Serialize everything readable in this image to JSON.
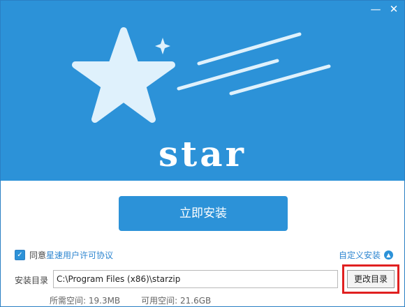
{
  "window": {
    "minimize_glyph": "—",
    "close_glyph": "✕"
  },
  "banner": {
    "brand": "star",
    "bg_color": "#2c92d8"
  },
  "install_button": "立即安装",
  "agreement": {
    "checked": true,
    "prefix": "同意",
    "link": "星速用户许可协议"
  },
  "custom_install": "自定义安装",
  "install_dir": {
    "label": "安装目录",
    "value": "C:\\Program Files (x86)\\starzip",
    "change_button": "更改目录"
  },
  "space": {
    "required": "所需空间: 19.3MB",
    "available": "可用空间: 21.6GB"
  },
  "icons": {
    "star": "star-icon",
    "sparkle": "sparkle-icon",
    "chevron": "chevron-up-icon",
    "check": "check-icon"
  }
}
